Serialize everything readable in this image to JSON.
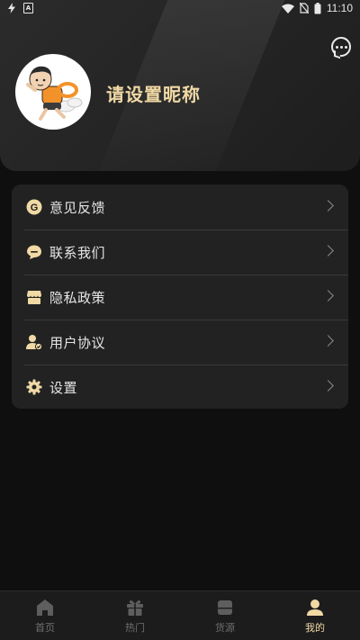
{
  "status_bar": {
    "time": "11:10",
    "left_icons": [
      "flash-icon",
      "a-box-icon"
    ],
    "right_icons": [
      "wifi-icon",
      "no-sim-icon",
      "battery-icon"
    ]
  },
  "profile": {
    "nickname": "请设置昵称",
    "avatar": "cartoon-avatar",
    "message_icon": "chat-bubble-icon"
  },
  "menu": {
    "items": [
      {
        "label": "意见反馈",
        "icon": "feedback-g-icon"
      },
      {
        "label": "联系我们",
        "icon": "contact-bubble-icon"
      },
      {
        "label": "隐私政策",
        "icon": "privacy-store-icon"
      },
      {
        "label": "用户协议",
        "icon": "user-agreement-icon"
      },
      {
        "label": "设置",
        "icon": "gear-icon"
      }
    ]
  },
  "tabbar": {
    "tabs": [
      {
        "label": "首页",
        "icon": "home-icon"
      },
      {
        "label": "热门",
        "icon": "gift-icon"
      },
      {
        "label": "货源",
        "icon": "bag-icon"
      },
      {
        "label": "我的",
        "icon": "profile-icon"
      }
    ],
    "active": "我的"
  },
  "colors": {
    "accent": "#f0d9a5",
    "background": "#0f0f0f",
    "card": "#222222"
  }
}
